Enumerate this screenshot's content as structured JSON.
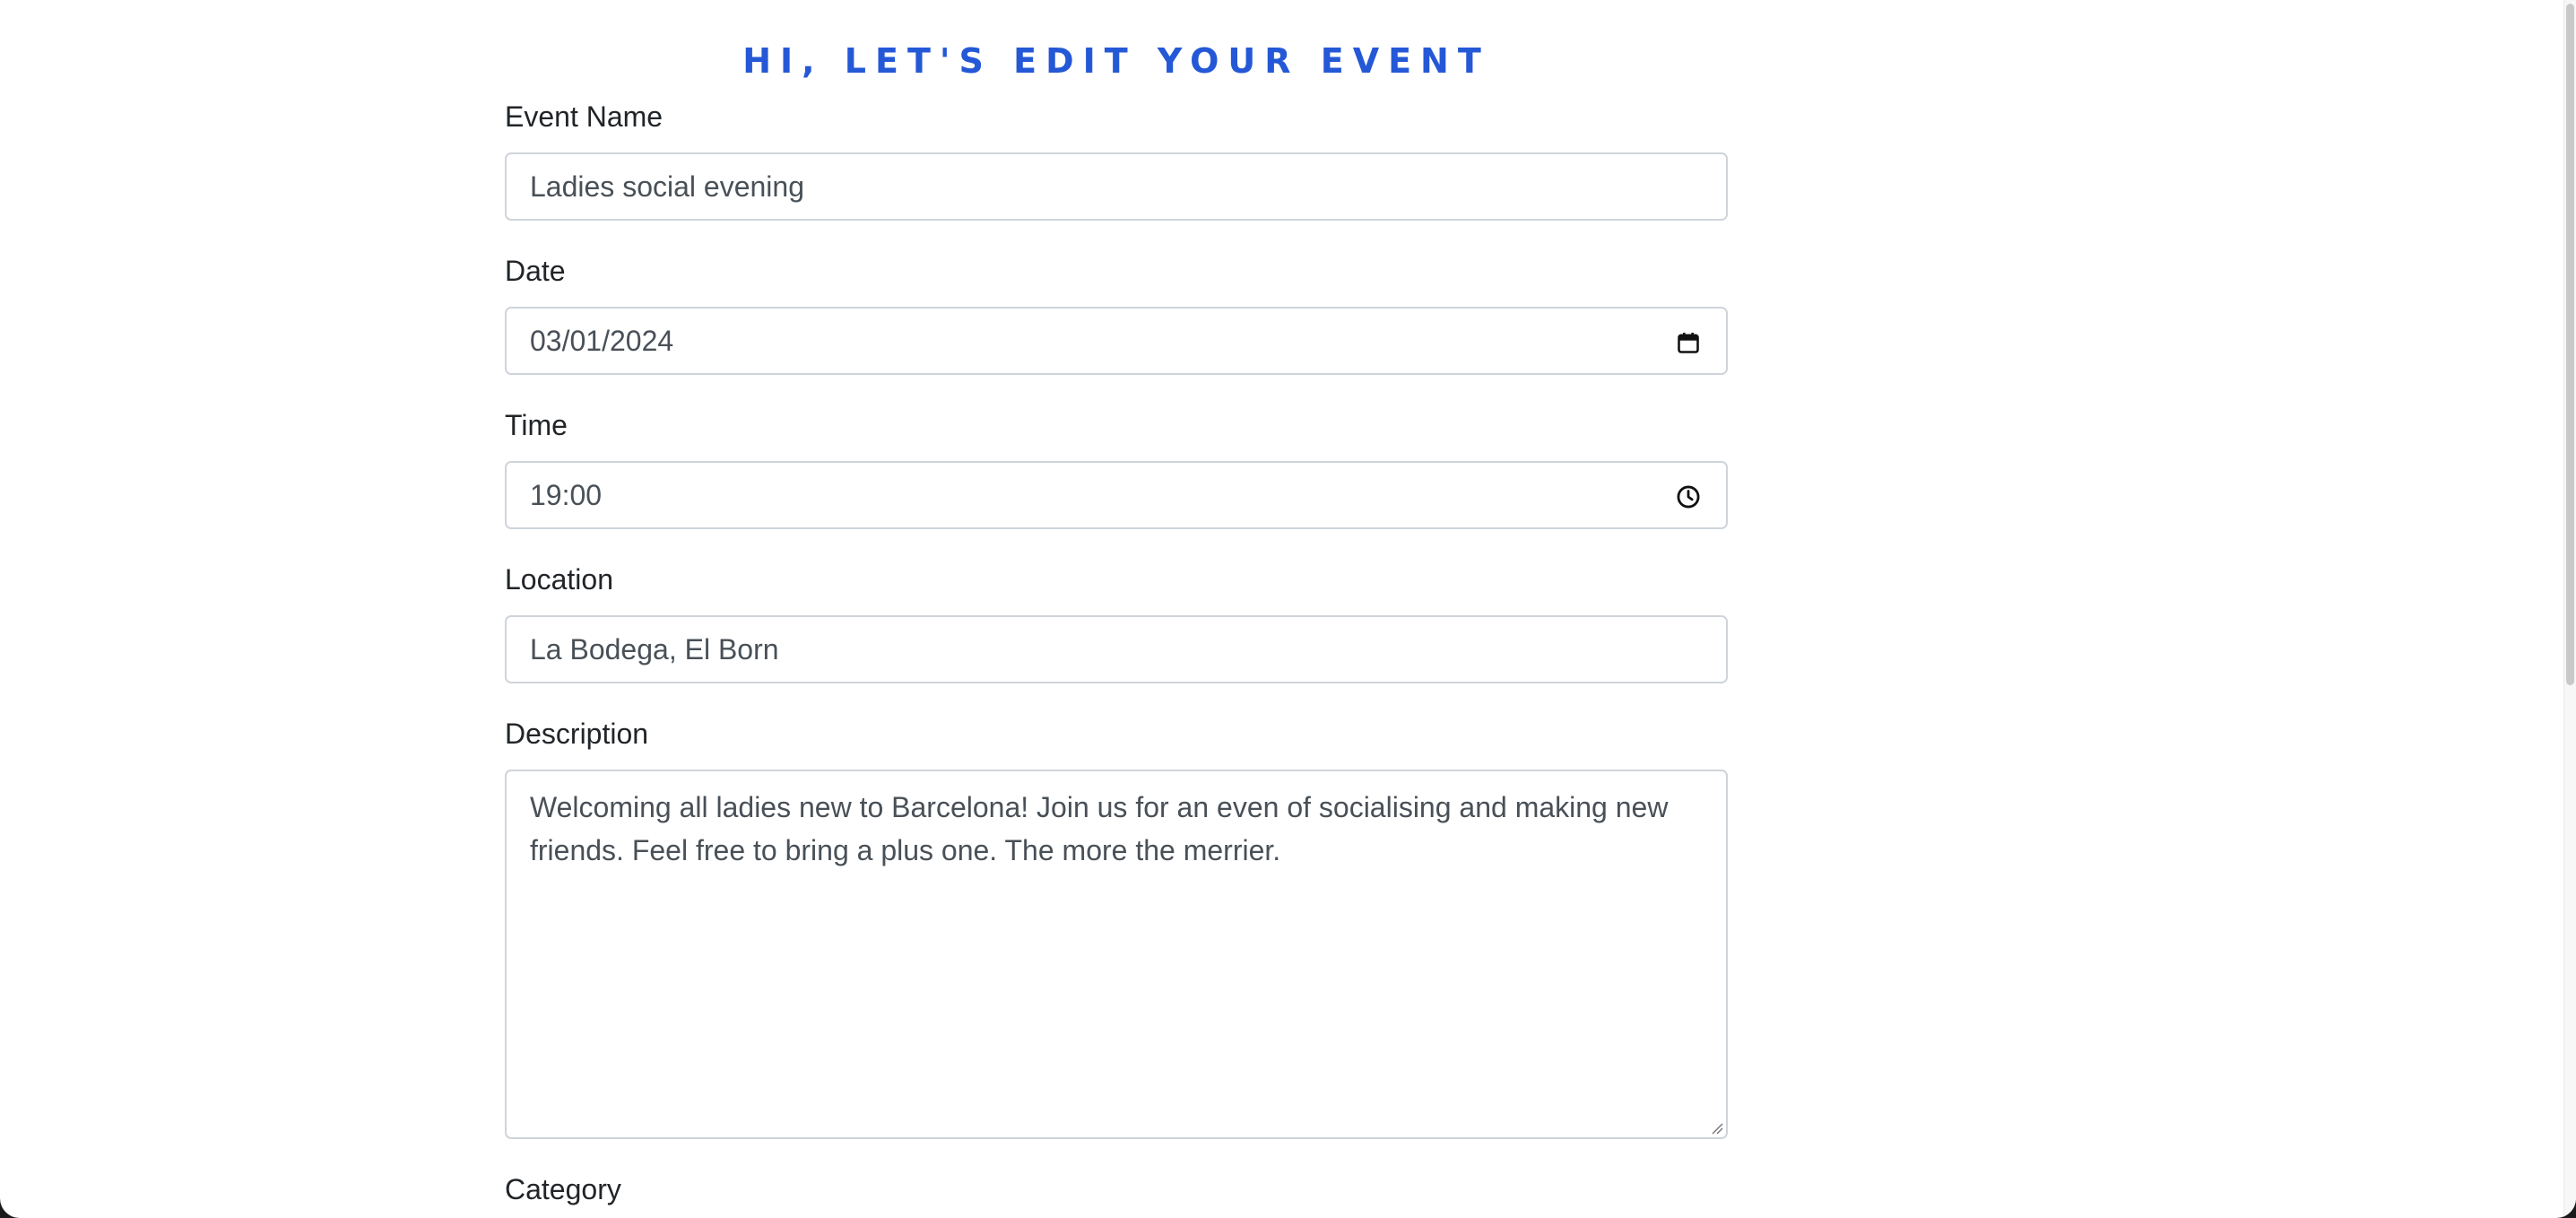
{
  "page": {
    "title": "HI, LET'S EDIT YOUR EVENT"
  },
  "form": {
    "event_name": {
      "label": "Event Name",
      "value": "Ladies social evening"
    },
    "date": {
      "label": "Date",
      "value": "03/01/2024",
      "icon": "calendar-icon"
    },
    "time": {
      "label": "Time",
      "value": "19:00",
      "icon": "clock-icon"
    },
    "location": {
      "label": "Location",
      "value": "La Bodega, El Born"
    },
    "description": {
      "label": "Description",
      "value": "Welcoming all ladies new to Barcelona! Join us for an even of socialising and making new friends. Feel free to bring a plus one. The more the merrier."
    },
    "category": {
      "label": "Category"
    }
  },
  "colors": {
    "title": "#2458d6",
    "text": "#212529",
    "input_text": "#495057",
    "input_border": "#cfd4da"
  }
}
